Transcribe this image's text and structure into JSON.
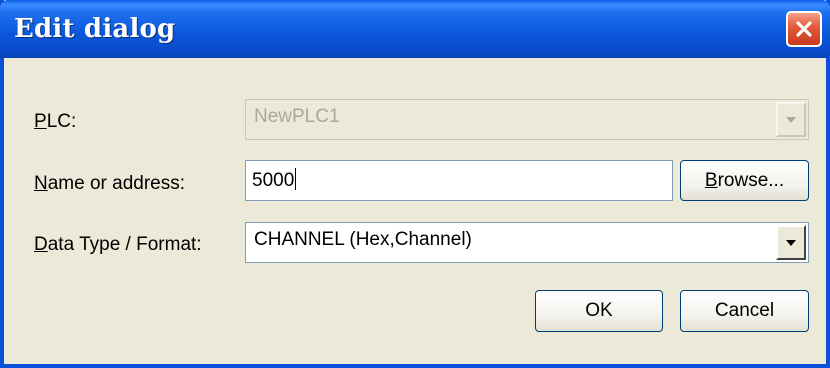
{
  "window": {
    "title": "Edit dialog"
  },
  "icons": {
    "close": "close-icon",
    "dropdown": "chevron-down-icon"
  },
  "fields": {
    "plc": {
      "label_mnemonic": "P",
      "label_rest": "LC:",
      "value": "NewPLC1",
      "disabled": true
    },
    "name_or_address": {
      "label_mnemonic": "N",
      "label_rest": "ame or address:",
      "value": "5000"
    },
    "data_type": {
      "label_mnemonic": "D",
      "label_rest": "ata Type / Format:",
      "value": "CHANNEL (Hex,Channel)"
    }
  },
  "buttons": {
    "browse_mnemonic": "B",
    "browse_rest": "rowse...",
    "ok": "OK",
    "cancel": "Cancel"
  },
  "colors": {
    "titlebar": "#0A56DA",
    "dialog_background": "#ECE9D8",
    "close_button": "#E2583A"
  }
}
